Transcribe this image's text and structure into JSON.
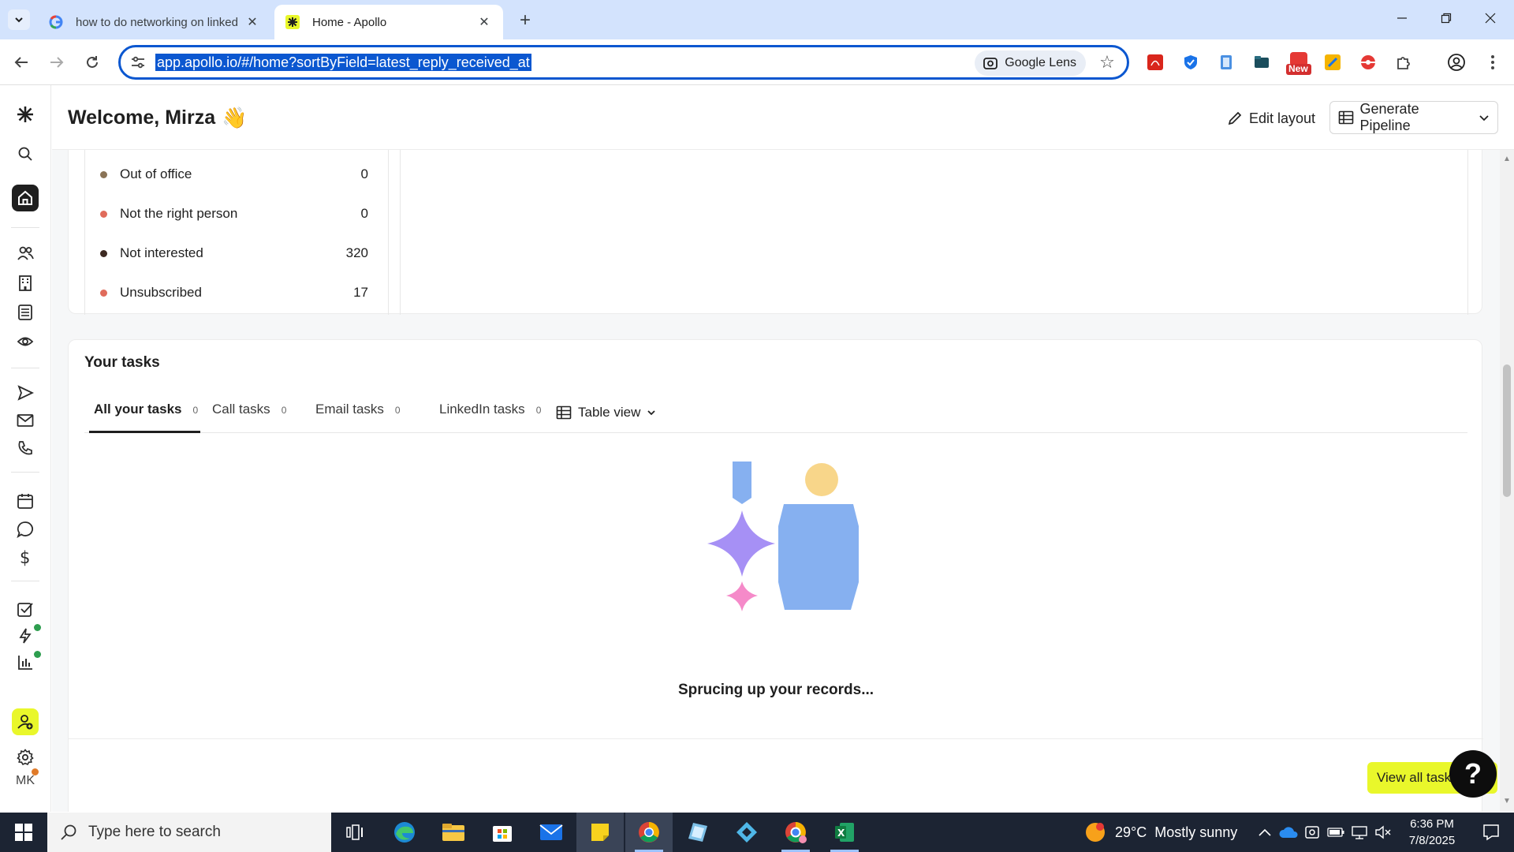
{
  "browser": {
    "tabs": [
      {
        "title": "how to do networking on linked",
        "active": false
      },
      {
        "title": "Home - Apollo",
        "active": true
      }
    ],
    "url": "app.apollo.io/#/home?sortByField=latest_reply_received_at",
    "lens_label": "Google Lens",
    "new_badge": "New"
  },
  "header": {
    "welcome": "Welcome, Mirza",
    "wave_emoji": "👋",
    "edit_layout": "Edit layout",
    "generate_pipeline": "Generate Pipeline"
  },
  "reply_reasons": [
    {
      "label": "Out of office",
      "value": "0",
      "color": "#8a7356"
    },
    {
      "label": "Not the right person",
      "value": "0",
      "color": "#e06b5b"
    },
    {
      "label": "Not interested",
      "value": "320",
      "color": "#3d2a22"
    },
    {
      "label": "Unsubscribed",
      "value": "17",
      "color": "#e06b5b"
    }
  ],
  "tasks": {
    "title": "Your tasks",
    "tabs": [
      {
        "label": "All your tasks",
        "count": "0"
      },
      {
        "label": "Call tasks",
        "count": "0"
      },
      {
        "label": "Email tasks",
        "count": "0"
      },
      {
        "label": "LinkedIn tasks",
        "count": "0"
      }
    ],
    "view_label": "Table view",
    "empty_message": "Sprucing up your records...",
    "view_all": "View all tasks"
  },
  "help_label": "?",
  "user_initials": "MK",
  "taskbar": {
    "search_placeholder": "Type here to search",
    "weather_temp": "29°C",
    "weather_desc": "Mostly sunny",
    "time": "6:36 PM",
    "date": "7/8/2025"
  },
  "colors": {
    "accent": "#0b57d0",
    "apollo_yellow": "#e9f72b"
  }
}
